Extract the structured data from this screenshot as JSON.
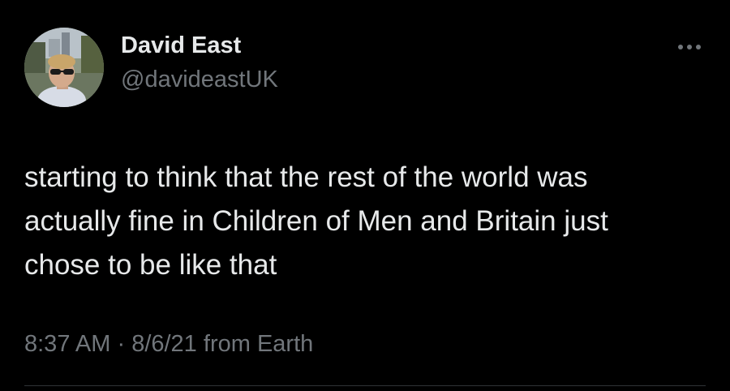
{
  "author": {
    "display_name": "David East",
    "handle": "@davideastUK"
  },
  "tweet": {
    "text": "starting to think that the rest of the world was\nactually fine in Children of Men and Britain just\nchose to be like that",
    "time": "8:37 AM",
    "separator": " · ",
    "date": "8/6/21",
    "source": " from Earth"
  },
  "icons": {
    "more": "more-horizontal-icon",
    "avatar": "profile-photo"
  },
  "colors": {
    "background": "#000000",
    "primary_text": "#e7e9ea",
    "secondary_text": "#71767b",
    "divider": "#2f3336"
  }
}
